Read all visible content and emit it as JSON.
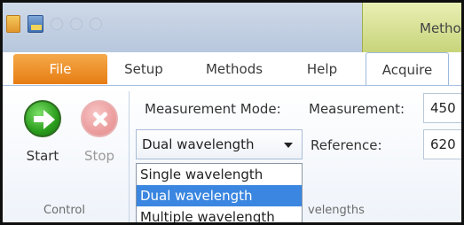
{
  "window": {
    "title_partial": "Metho"
  },
  "tabs": {
    "file": "File",
    "setup": "Setup",
    "methods": "Methods",
    "help": "Help",
    "acquire": "Acquire"
  },
  "control": {
    "start_label": "Start",
    "stop_label": "Stop",
    "group_label": "Control"
  },
  "measurement": {
    "mode_label": "Measurement Mode:",
    "mode_value": "Dual wavelength",
    "options": [
      "Single wavelength",
      "Dual wavelength",
      "Multiple wavelength"
    ],
    "selected_index": 1
  },
  "wavelengths": {
    "measurement_label": "Measurement:",
    "measurement_value": "450",
    "reference_label": "Reference:",
    "reference_value": "620",
    "group_label_partial": "velengths"
  },
  "colors": {
    "file_tab": "#e77d13",
    "selection": "#3a86e0",
    "start_green": "#2a9d1c"
  }
}
